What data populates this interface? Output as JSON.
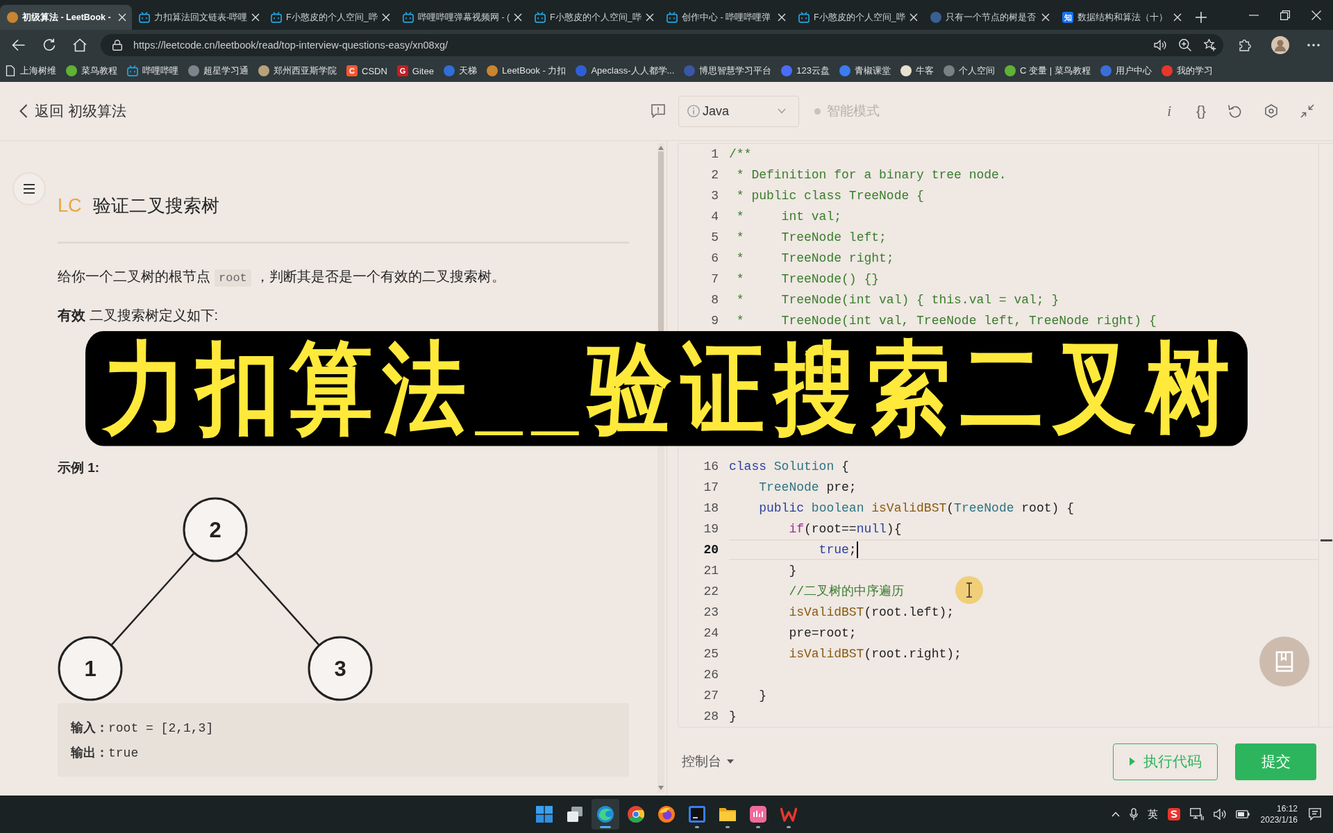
{
  "browser": {
    "tabs": [
      {
        "title": "初级算法 - LeetBook -",
        "selected": true,
        "kind": "disc",
        "color": "#c9852f"
      },
      {
        "title": "力扣算法回文链表-哔哩",
        "selected": false,
        "kind": "tv"
      },
      {
        "title": "F小憨皮的个人空间_哔",
        "selected": false,
        "kind": "tv"
      },
      {
        "title": "哔哩哔哩弹幕视频网 - (",
        "selected": false,
        "kind": "tv"
      },
      {
        "title": "F小憨皮的个人空间_哔",
        "selected": false,
        "kind": "tv"
      },
      {
        "title": "创作中心 - 哔哩哔哩弹",
        "selected": false,
        "kind": "tv"
      },
      {
        "title": "F小憨皮的个人空间_哔",
        "selected": false,
        "kind": "tv"
      },
      {
        "title": "只有一个节点的树是否",
        "selected": false,
        "kind": "disc",
        "color": "#3a5f95"
      },
      {
        "title": "数据结构和算法（十）",
        "selected": false,
        "kind": "letter",
        "icon_label": "知",
        "color": "#1772f6"
      }
    ],
    "url": "https://leetcode.cn/leetbook/read/top-interview-questions-easy/xn08xg/",
    "bookmarks": [
      {
        "label": "上海树维",
        "kind": "page"
      },
      {
        "label": "菜鸟教程",
        "kind": "disc",
        "color": "#5fb236"
      },
      {
        "label": "哔哩哔哩",
        "kind": "tv"
      },
      {
        "label": "超星学习通",
        "kind": "disc",
        "color": "#7d858a"
      },
      {
        "label": "郑州西亚斯学院",
        "kind": "disc",
        "color": "#b8a27a"
      },
      {
        "label": "CSDN",
        "kind": "letter",
        "icon_label": "C",
        "color": "#fc5531"
      },
      {
        "label": "Gitee",
        "kind": "letter",
        "icon_label": "G",
        "color": "#c71d23"
      },
      {
        "label": "天梯",
        "kind": "disc",
        "color": "#2f6fd6"
      },
      {
        "label": "LeetBook - 力扣",
        "kind": "disc",
        "color": "#c9852f"
      },
      {
        "label": "Apeclass-人人都学...",
        "kind": "disc",
        "color": "#2f5fd6"
      },
      {
        "label": "博思智慧学习平台",
        "kind": "disc",
        "color": "#3a56a8"
      },
      {
        "label": "123云盘",
        "kind": "disc",
        "color": "#4a6cf7"
      },
      {
        "label": "青椒课堂",
        "kind": "disc",
        "color": "#3d7bf0"
      },
      {
        "label": "牛客",
        "kind": "disc",
        "color": "#e8e1d0"
      },
      {
        "label": "个人空间",
        "kind": "disc",
        "color": "#7a8185"
      },
      {
        "label": "C 变量 | 菜鸟教程",
        "kind": "disc",
        "color": "#5fb236"
      },
      {
        "label": "用户中心",
        "kind": "disc",
        "color": "#3a6fd8"
      },
      {
        "label": "我的学习",
        "kind": "disc",
        "color": "#e8372c"
      }
    ]
  },
  "page_header": {
    "back_label": "返回 初级算法",
    "language": "Java",
    "smart_mode": {
      "label": "智能模式",
      "on": false
    },
    "tools": [
      {
        "kind": "info",
        "glyph": "i"
      },
      {
        "kind": "format",
        "glyph": "{}"
      },
      {
        "kind": "reset"
      },
      {
        "kind": "settings"
      },
      {
        "kind": "collapse"
      }
    ]
  },
  "problem": {
    "source": "LC",
    "title": "验证二叉搜索树",
    "description": [
      {
        "kind": "text",
        "text": "给你一个二叉树的根节点"
      },
      {
        "kind": "code",
        "text": "root"
      },
      {
        "kind": "text",
        "text": "，判断其是否是一个有效的二叉搜索树。"
      }
    ],
    "definition": "**有效** 二叉搜索树定义如下:",
    "example": {
      "heading": "示例 1:",
      "tree": {
        "value": "2",
        "children": [
          {
            "value": "1"
          },
          {
            "value": "3"
          }
        ]
      },
      "lines": [
        "**输入：**root = [2,1,3]",
        "**输出：**true"
      ]
    }
  },
  "editor": {
    "lines": [
      {
        "num": "1",
        "current": false,
        "tokens": [
          {
            "text": "/**",
            "kind": "comment"
          }
        ]
      },
      {
        "num": "2",
        "current": false,
        "tokens": [
          {
            "text": " * Definition for a binary tree node.",
            "kind": "comment"
          }
        ]
      },
      {
        "num": "3",
        "current": false,
        "tokens": [
          {
            "text": " * public class TreeNode {",
            "kind": "comment"
          }
        ]
      },
      {
        "num": "4",
        "current": false,
        "tokens": [
          {
            "text": " *     int val;",
            "kind": "comment"
          }
        ]
      },
      {
        "num": "5",
        "current": false,
        "tokens": [
          {
            "text": " *     TreeNode left;",
            "kind": "comment"
          }
        ]
      },
      {
        "num": "6",
        "current": false,
        "tokens": [
          {
            "text": " *     TreeNode right;",
            "kind": "comment"
          }
        ]
      },
      {
        "num": "7",
        "current": false,
        "tokens": [
          {
            "text": " *     TreeNode() {}",
            "kind": "comment"
          }
        ]
      },
      {
        "num": "8",
        "current": false,
        "tokens": [
          {
            "text": " *     TreeNode(int val) { this.val = val; }",
            "kind": "comment"
          }
        ]
      },
      {
        "num": "9",
        "current": false,
        "tokens": [
          {
            "text": " *     TreeNode(int val, TreeNode left, TreeNode right) {",
            "kind": "comment"
          }
        ]
      },
      {
        "num": "16",
        "current": false,
        "tokens": [
          {
            "text": "class ",
            "kind": "keyword"
          },
          {
            "text": "Solution",
            "kind": "type"
          },
          {
            "text": " {",
            "kind": "plain"
          }
        ]
      },
      {
        "num": "17",
        "current": false,
        "tokens": [
          {
            "text": "    TreeNode",
            "kind": "type"
          },
          {
            "text": " pre;",
            "kind": "plain"
          }
        ]
      },
      {
        "num": "18",
        "current": false,
        "tokens": [
          {
            "text": "    public ",
            "kind": "keyword"
          },
          {
            "text": "boolean ",
            "kind": "type"
          },
          {
            "text": "isValidBST",
            "kind": "function"
          },
          {
            "text": "(",
            "kind": "plain"
          },
          {
            "text": "TreeNode",
            "kind": "type"
          },
          {
            "text": " root) {",
            "kind": "plain"
          }
        ]
      },
      {
        "num": "19",
        "current": false,
        "tokens": [
          {
            "text": "        if",
            "kind": "control"
          },
          {
            "text": "(root==",
            "kind": "plain"
          },
          {
            "text": "null",
            "kind": "keyword"
          },
          {
            "text": "){",
            "kind": "plain"
          }
        ]
      },
      {
        "num": "20",
        "current": true,
        "tokens": [
          {
            "text": "            true",
            "kind": "keyword"
          },
          {
            "text": ";",
            "kind": "plain"
          }
        ]
      },
      {
        "num": "21",
        "current": false,
        "tokens": [
          {
            "text": "        }",
            "kind": "plain"
          }
        ]
      },
      {
        "num": "22",
        "current": false,
        "tokens": [
          {
            "text": "        //二叉树的中序遍历",
            "kind": "comment"
          }
        ]
      },
      {
        "num": "23",
        "current": false,
        "tokens": [
          {
            "text": "        isValidBST",
            "kind": "function"
          },
          {
            "text": "(root.left);",
            "kind": "plain"
          }
        ]
      },
      {
        "num": "24",
        "current": false,
        "tokens": [
          {
            "text": "        pre=root;",
            "kind": "plain"
          }
        ]
      },
      {
        "num": "25",
        "current": false,
        "tokens": [
          {
            "text": "        isValidBST",
            "kind": "function"
          },
          {
            "text": "(root.right);",
            "kind": "plain"
          }
        ]
      },
      {
        "num": "26",
        "current": false
      },
      {
        "num": "27",
        "current": false,
        "tokens": [
          {
            "text": "    }",
            "kind": "plain"
          }
        ]
      },
      {
        "num": "28",
        "current": false,
        "tokens": [
          {
            "text": "}",
            "kind": "plain"
          }
        ]
      }
    ],
    "console_label": "控制台",
    "run_label": "执行代码",
    "submit_label": "提交"
  },
  "overlay_title": "力扣算法__验证搜索二叉树",
  "taskbar": {
    "apps": [
      {
        "kind": "start",
        "running": false,
        "selected": false
      },
      {
        "kind": "task_view",
        "running": false,
        "selected": false
      },
      {
        "kind": "swirl",
        "running": true,
        "selected": true
      },
      {
        "kind": "pinwheel",
        "running": false,
        "selected": false
      },
      {
        "kind": "flame",
        "running": false,
        "selected": false
      },
      {
        "kind": "ide",
        "running": true,
        "selected": false
      },
      {
        "kind": "folder",
        "running": true,
        "selected": false
      },
      {
        "kind": "media",
        "running": true,
        "selected": false
      },
      {
        "kind": "office",
        "running": true,
        "selected": false
      }
    ],
    "ime": "英",
    "time": "16:12",
    "date": "2023/1/16"
  }
}
